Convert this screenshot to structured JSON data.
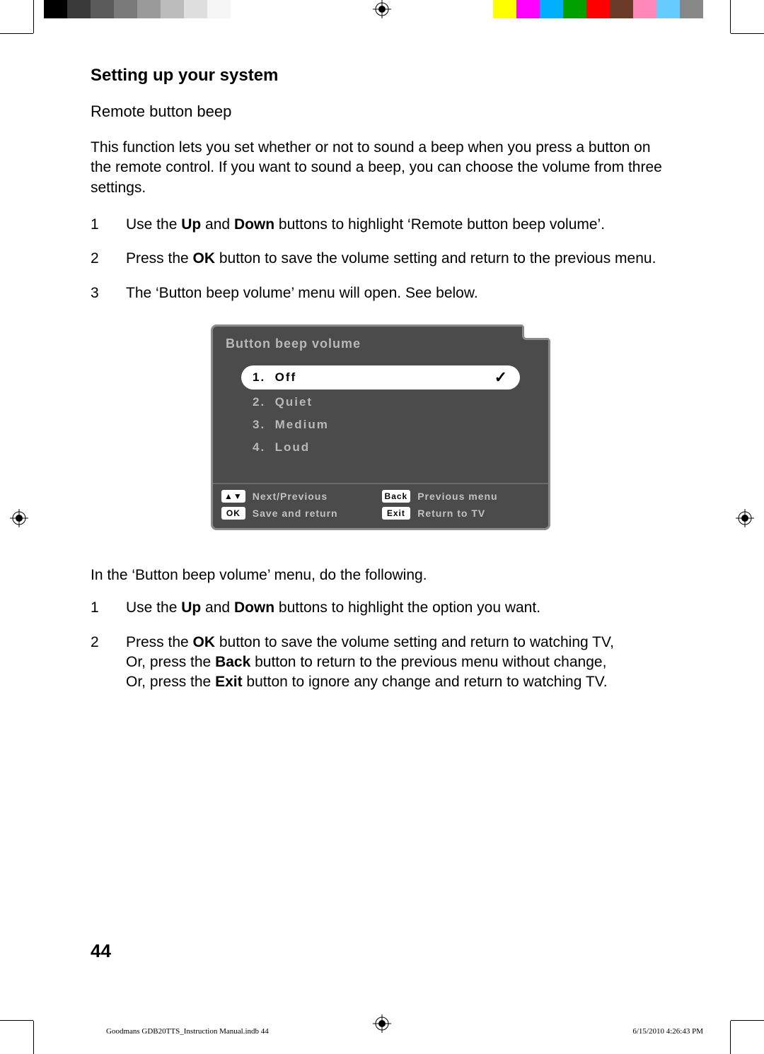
{
  "colorbars": {
    "left": [
      "#000000",
      "#3a3a3a",
      "#5a5a5a",
      "#7a7a7a",
      "#9a9a9a",
      "#bcbcbc",
      "#dedede",
      "#f5f5f5",
      "#ffffff"
    ],
    "right": [
      "#ffff00",
      "#ff00ff",
      "#00b0ff",
      "#00a000",
      "#ff0000",
      "#6b3b2a",
      "#ff88bb",
      "#66ccff",
      "#888888"
    ]
  },
  "section": {
    "title": "Setting up your system",
    "subtitle": "Remote button beep",
    "intro": "This function lets you set whether or not to sound a beep when you press a button on the remote control. If you want to sound a beep, you can choose the volume from three settings."
  },
  "steps_a": [
    {
      "n": "1",
      "html": "Use the <b>Up</b> and <b>Down</b> buttons to highlight ‘Remote button beep volume’."
    },
    {
      "n": "2",
      "html": "Press the <b>OK</b> button to save the volume setting and return to the previous menu."
    },
    {
      "n": "3",
      "html": "The ‘Button beep volume’ menu will open. See below."
    }
  ],
  "osd": {
    "title": "Button beep volume",
    "options": [
      {
        "id": 1,
        "label": "1.  Off",
        "selected": true
      },
      {
        "id": 2,
        "label": "2.  Quiet",
        "selected": false
      },
      {
        "id": 3,
        "label": "3.  Medium",
        "selected": false
      },
      {
        "id": 4,
        "label": "4.  Loud",
        "selected": false
      }
    ],
    "legend": {
      "updown": {
        "key": "▲▼",
        "label": "Next/Previous"
      },
      "back": {
        "key": "Back",
        "label": "Previous menu"
      },
      "ok": {
        "key": "OK",
        "label": "Save and return"
      },
      "exit": {
        "key": "Exit",
        "label": "Return to TV"
      }
    }
  },
  "post_menu_text": "In the ‘Button beep volume’ menu, do the following.",
  "steps_b": [
    {
      "n": "1",
      "html": "Use the <b>Up</b> and <b>Down</b> buttons to highlight the option you want."
    },
    {
      "n": "2",
      "html": "Press the <b>OK</b> button to save the volume setting and return to watching TV,<br>Or, press the <b>Back</b> button to return to the previous menu without change,<br>Or, press the <b>Exit</b> button to ignore any change and return to watching TV."
    }
  ],
  "page_number": "44",
  "footer": {
    "left": "Goodmans GDB20TTS_Instruction Manual.indb   44",
    "right": "6/15/2010   4:26:43 PM"
  }
}
